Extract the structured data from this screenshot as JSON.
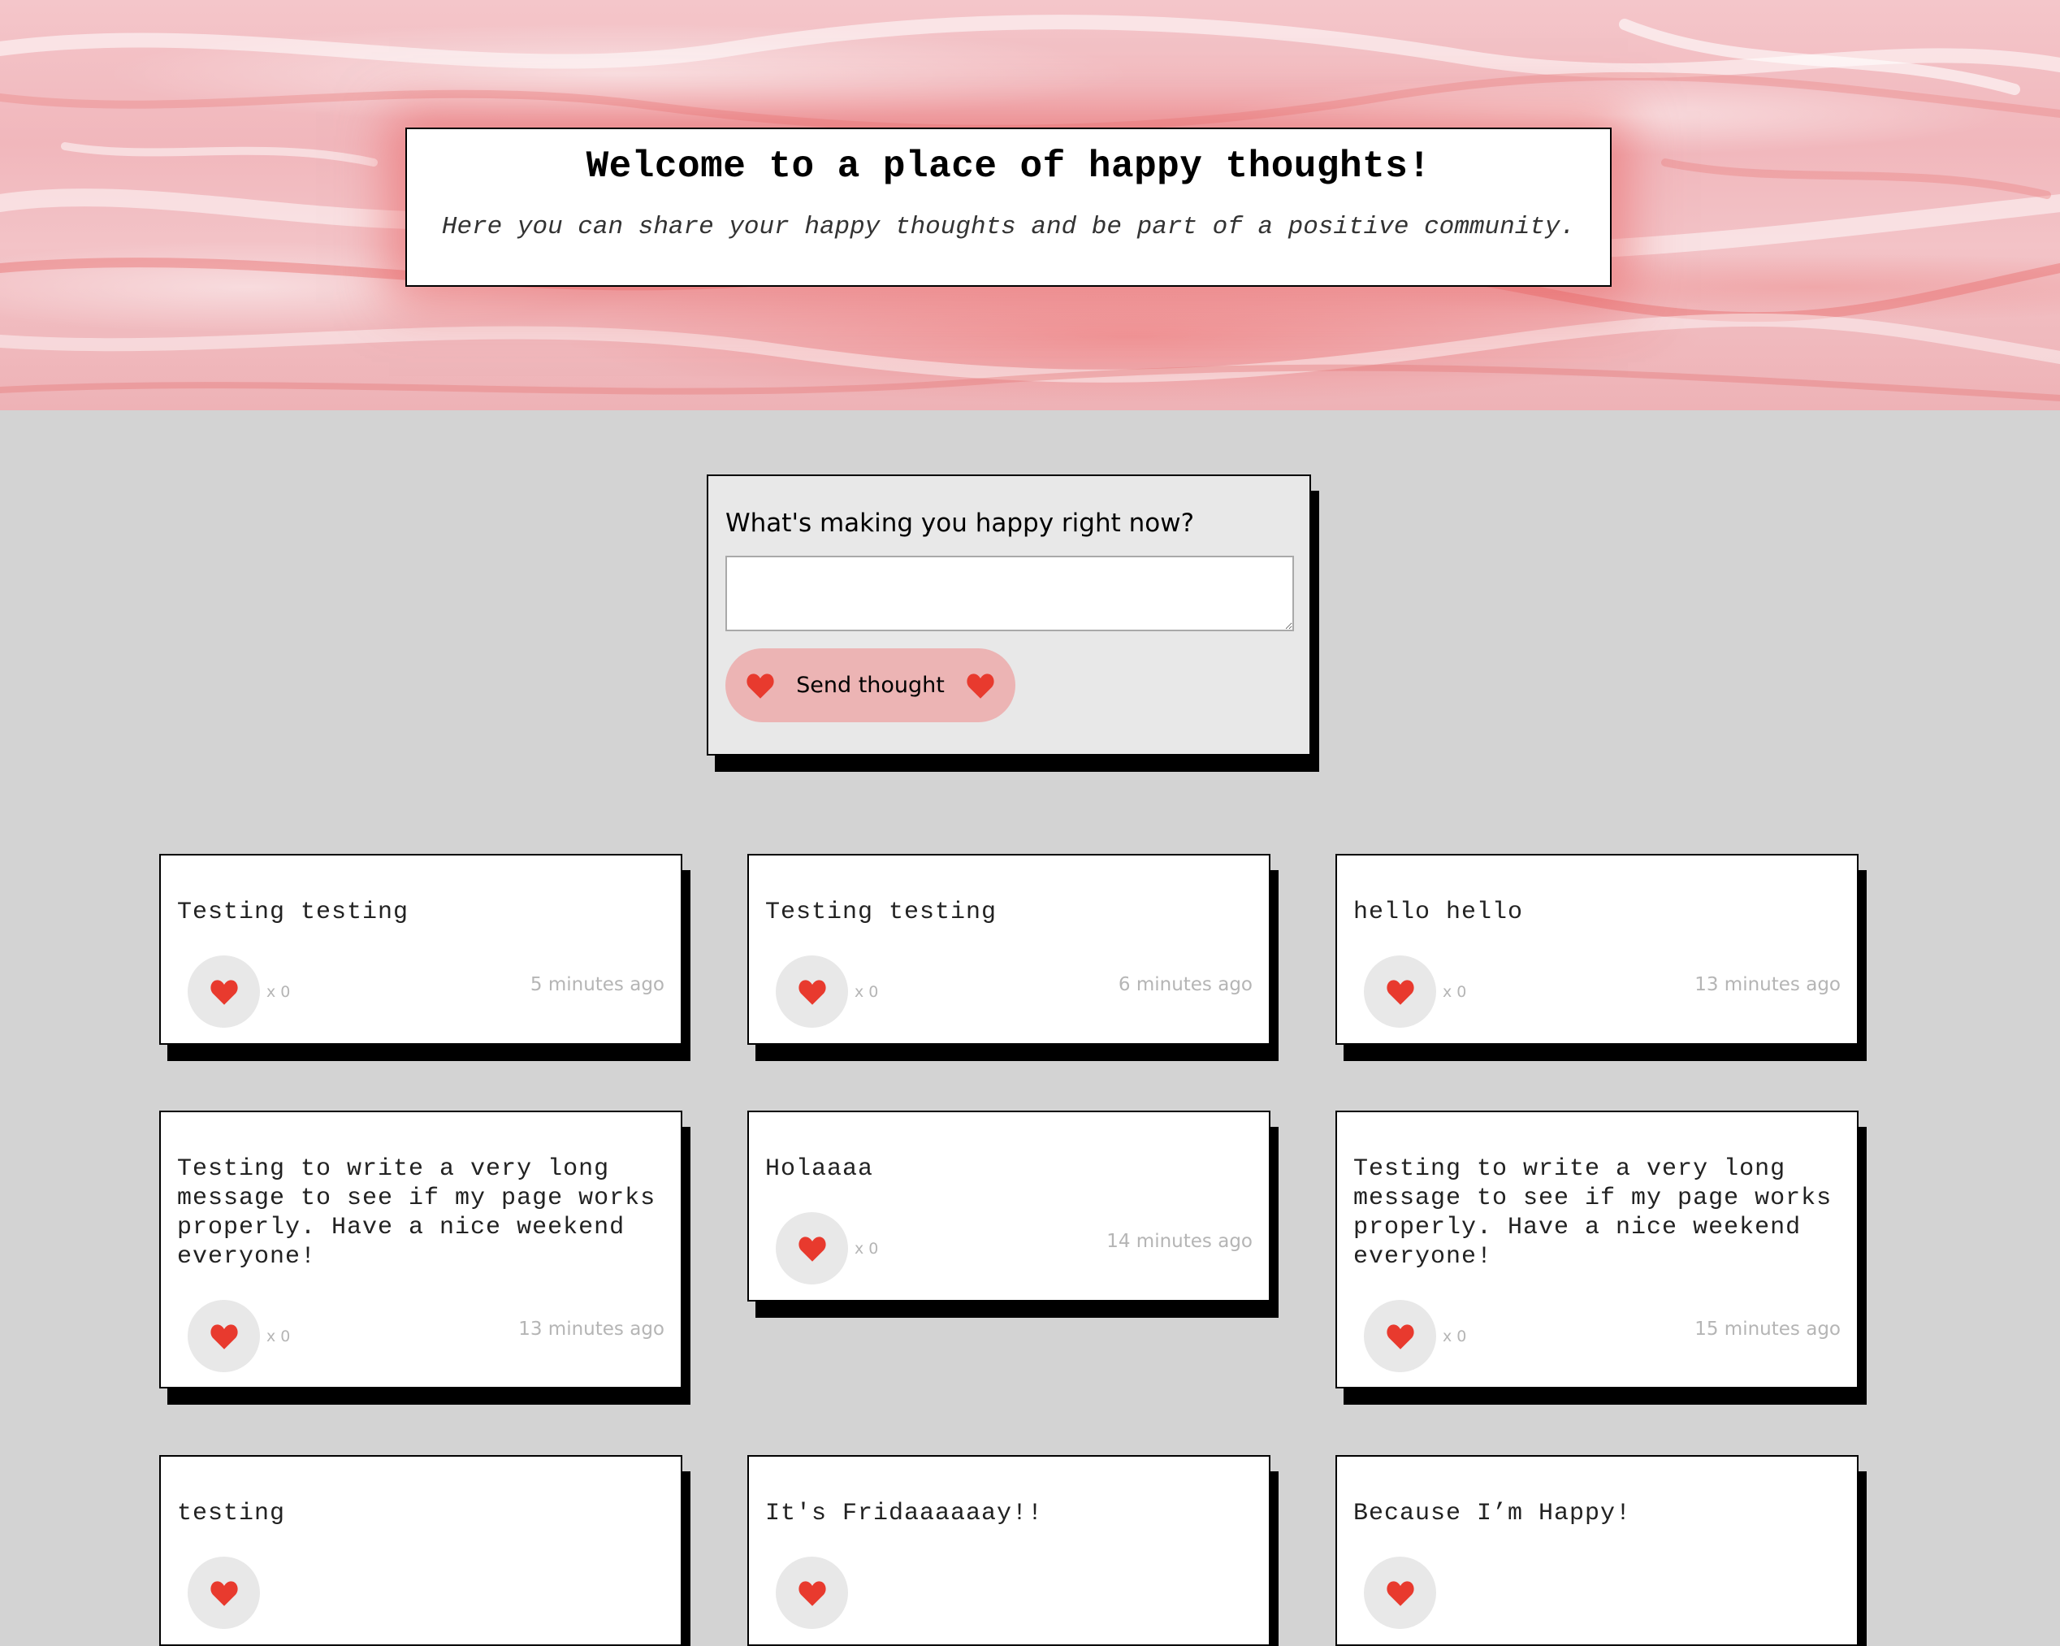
{
  "header": {
    "title": "Welcome to a place of happy thoughts!",
    "subtitle": "Here you can share your happy thoughts and be part of a positive community."
  },
  "form": {
    "label": "What's making you happy right now?",
    "input_value": "",
    "button_label": "Send thought"
  },
  "colors": {
    "heart": "#e83a2e",
    "button_bg": "#ecb4b4",
    "page_bg": "#d3d3d3",
    "hero_pink": "#f1b7bc"
  },
  "thoughts": [
    {
      "message": "Testing testing",
      "likes": "x 0",
      "time": "5 minutes ago"
    },
    {
      "message": "Testing testing",
      "likes": "x 0",
      "time": "6 minutes ago"
    },
    {
      "message": "hello hello",
      "likes": "x 0",
      "time": "13 minutes ago"
    },
    {
      "message": "Testing to write a very long message to see if my page works properly. Have a nice weekend everyone!",
      "likes": "x 0",
      "time": "13 minutes ago"
    },
    {
      "message": "Holaaaa",
      "likes": "x 0",
      "time": "14 minutes ago"
    },
    {
      "message": "Testing to write a very long message to see if my page works properly. Have a nice weekend everyone!",
      "likes": "x 0",
      "time": "15 minutes ago"
    },
    {
      "message": "testing"
    },
    {
      "message": "It's Fridaaaaaay!!"
    },
    {
      "message": "Because I’m Happy!"
    }
  ]
}
